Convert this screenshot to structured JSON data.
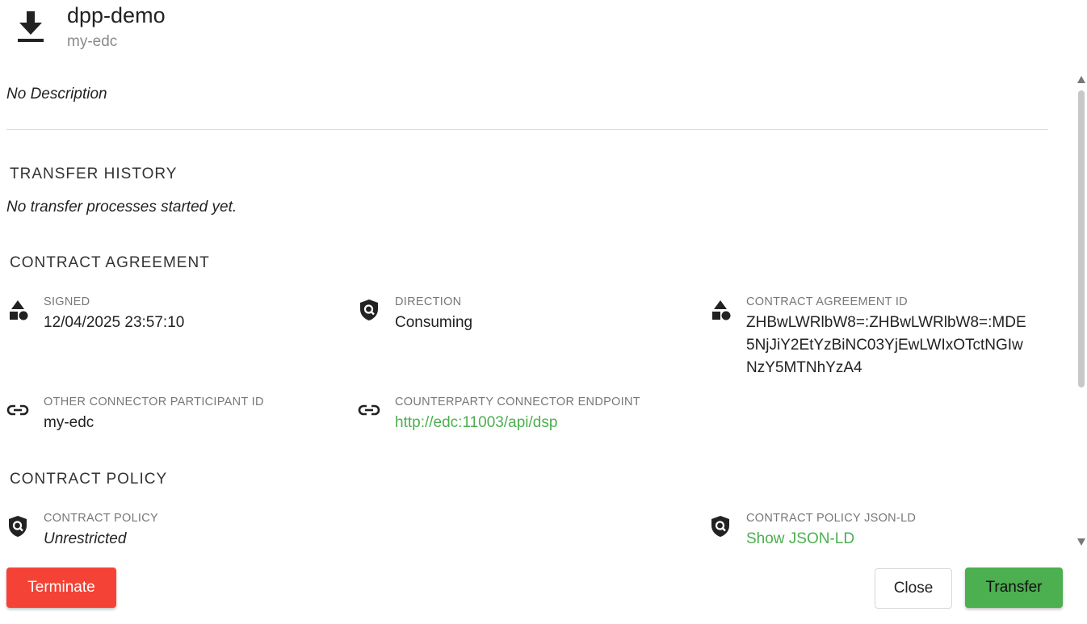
{
  "header": {
    "icon": "download-icon",
    "title": "dpp-demo",
    "subtitle": "my-edc"
  },
  "description": "No Description",
  "transfer_history": {
    "heading": "TRANSFER HISTORY",
    "empty_text": "No transfer processes started yet."
  },
  "contract_agreement": {
    "heading": "CONTRACT AGREEMENT",
    "signed": {
      "icon": "shapes-icon",
      "label": "SIGNED",
      "value": "12/04/2025 23:57:10"
    },
    "direction": {
      "icon": "policy-shield-icon",
      "label": "DIRECTION",
      "value": "Consuming"
    },
    "agreement_id": {
      "icon": "shapes-icon",
      "label": "CONTRACT AGREEMENT ID",
      "value_lines": [
        "ZHBwLWRlbW8=:ZHBwLWRlbW8=:MDE",
        "5NjJiY2EtYzBiNC03YjEwLWIxOTctNGIw",
        "NzY5MTNhYzA4"
      ]
    },
    "participant_id": {
      "icon": "link-icon",
      "label": "OTHER CONNECTOR PARTICIPANT ID",
      "value": "my-edc"
    },
    "endpoint": {
      "icon": "link-icon",
      "label": "COUNTERPARTY CONNECTOR ENDPOINT",
      "value": "http://edc:11003/api/dsp"
    }
  },
  "contract_policy": {
    "heading": "CONTRACT POLICY",
    "policy": {
      "icon": "policy-shield-icon",
      "label": "CONTRACT POLICY",
      "value": "Unrestricted"
    },
    "json_ld": {
      "icon": "policy-shield-icon",
      "label": "CONTRACT POLICY JSON-LD",
      "value": "Show JSON-LD"
    }
  },
  "buttons": {
    "terminate": "Terminate",
    "close": "Close",
    "transfer": "Transfer"
  },
  "colors": {
    "danger": "#f44336",
    "success": "#4caf50",
    "link": "#4caf50"
  }
}
